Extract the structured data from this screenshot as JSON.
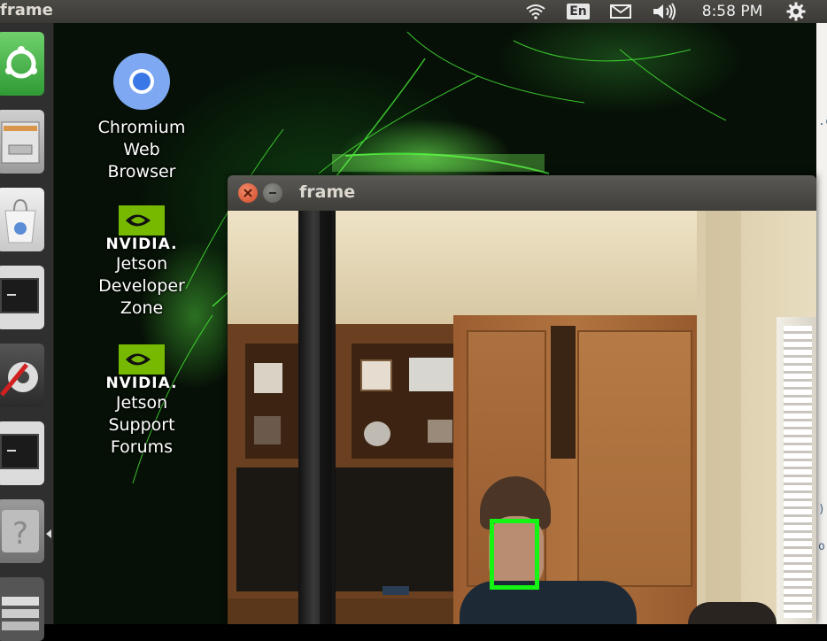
{
  "top_panel": {
    "app_title": "frame",
    "language": "En",
    "clock": "8:58 PM"
  },
  "desktop": {
    "icons": [
      {
        "name": "Chromium Web Browser",
        "label": "Chromium\nWeb\nBrowser"
      },
      {
        "brand": "NVIDIA.",
        "label": "Jetson\nDeveloper\nZone"
      },
      {
        "brand": "NVIDIA.",
        "label": "Jetson\nSupport\nForums"
      }
    ]
  },
  "launcher": {
    "items": [
      "ubuntu-dash-icon",
      "files-icon",
      "software-center-icon",
      "terminal-icon",
      "system-settings-icon",
      "terminal-icon",
      "help-icon",
      "workspace-switcher-icon"
    ]
  },
  "frame_window": {
    "title": "frame",
    "face_box_color": "#14f514"
  },
  "right_strip": {
    "fragments": [
      ".c",
      ")",
      "o."
    ]
  }
}
